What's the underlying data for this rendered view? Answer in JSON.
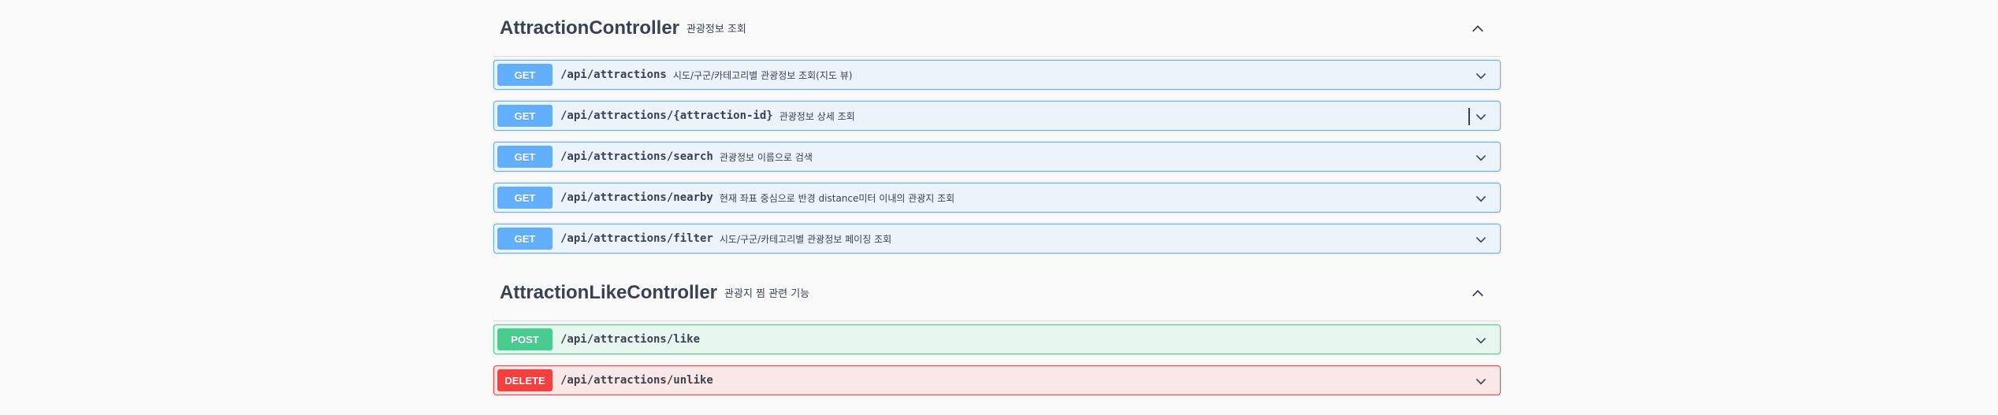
{
  "sections": [
    {
      "name": "AttractionController",
      "description": "관광정보 조회",
      "operations": [
        {
          "method": "GET",
          "path": "/api/attractions",
          "summary": "시도/구군/카테고리별 관광정보 조회(지도 뷰)"
        },
        {
          "method": "GET",
          "path": "/api/attractions/{attraction-id}",
          "summary": "관광정보 상세 조회"
        },
        {
          "method": "GET",
          "path": "/api/attractions/search",
          "summary": "관광정보 이름으로 검색"
        },
        {
          "method": "GET",
          "path": "/api/attractions/nearby",
          "summary": "현재 좌표 중심으로 반경 distance미터 이내의 관광지 조회"
        },
        {
          "method": "GET",
          "path": "/api/attractions/filter",
          "summary": "시도/구군/카테고리별 관광정보 페이징 조회"
        }
      ]
    },
    {
      "name": "AttractionLikeController",
      "description": "관광지 찜 관련 기능",
      "operations": [
        {
          "method": "POST",
          "path": "/api/attractions/like",
          "summary": ""
        },
        {
          "method": "DELETE",
          "path": "/api/attractions/unlike",
          "summary": ""
        }
      ]
    }
  ],
  "colors": {
    "get": "#61affe",
    "post": "#49cc90",
    "delete": "#f93e3e",
    "text": "#3b4151"
  },
  "icons": {
    "collapse": "chevron-up-icon",
    "expand": "chevron-down-icon"
  }
}
